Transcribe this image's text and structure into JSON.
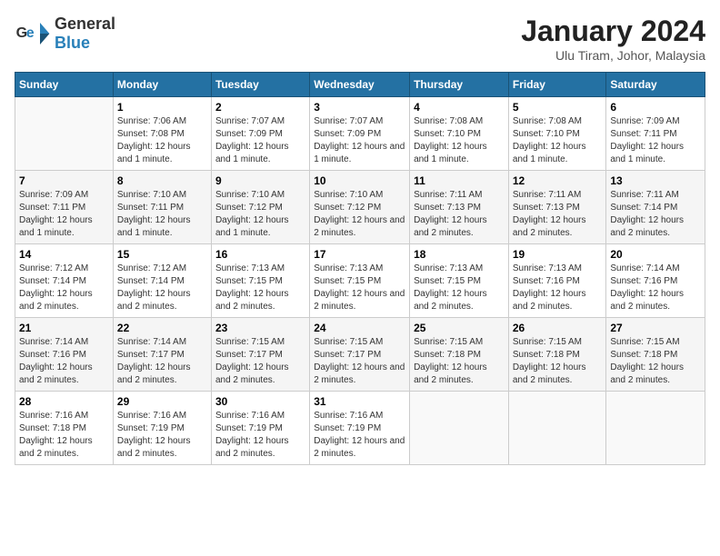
{
  "header": {
    "logo_general": "General",
    "logo_blue": "Blue",
    "month_title": "January 2024",
    "location": "Ulu Tiram, Johor, Malaysia"
  },
  "days_of_week": [
    "Sunday",
    "Monday",
    "Tuesday",
    "Wednesday",
    "Thursday",
    "Friday",
    "Saturday"
  ],
  "weeks": [
    [
      {
        "num": "",
        "sunrise": "",
        "sunset": "",
        "daylight": ""
      },
      {
        "num": "1",
        "sunrise": "Sunrise: 7:06 AM",
        "sunset": "Sunset: 7:08 PM",
        "daylight": "Daylight: 12 hours and 1 minute."
      },
      {
        "num": "2",
        "sunrise": "Sunrise: 7:07 AM",
        "sunset": "Sunset: 7:09 PM",
        "daylight": "Daylight: 12 hours and 1 minute."
      },
      {
        "num": "3",
        "sunrise": "Sunrise: 7:07 AM",
        "sunset": "Sunset: 7:09 PM",
        "daylight": "Daylight: 12 hours and 1 minute."
      },
      {
        "num": "4",
        "sunrise": "Sunrise: 7:08 AM",
        "sunset": "Sunset: 7:10 PM",
        "daylight": "Daylight: 12 hours and 1 minute."
      },
      {
        "num": "5",
        "sunrise": "Sunrise: 7:08 AM",
        "sunset": "Sunset: 7:10 PM",
        "daylight": "Daylight: 12 hours and 1 minute."
      },
      {
        "num": "6",
        "sunrise": "Sunrise: 7:09 AM",
        "sunset": "Sunset: 7:11 PM",
        "daylight": "Daylight: 12 hours and 1 minute."
      }
    ],
    [
      {
        "num": "7",
        "sunrise": "Sunrise: 7:09 AM",
        "sunset": "Sunset: 7:11 PM",
        "daylight": "Daylight: 12 hours and 1 minute."
      },
      {
        "num": "8",
        "sunrise": "Sunrise: 7:10 AM",
        "sunset": "Sunset: 7:11 PM",
        "daylight": "Daylight: 12 hours and 1 minute."
      },
      {
        "num": "9",
        "sunrise": "Sunrise: 7:10 AM",
        "sunset": "Sunset: 7:12 PM",
        "daylight": "Daylight: 12 hours and 1 minute."
      },
      {
        "num": "10",
        "sunrise": "Sunrise: 7:10 AM",
        "sunset": "Sunset: 7:12 PM",
        "daylight": "Daylight: 12 hours and 2 minutes."
      },
      {
        "num": "11",
        "sunrise": "Sunrise: 7:11 AM",
        "sunset": "Sunset: 7:13 PM",
        "daylight": "Daylight: 12 hours and 2 minutes."
      },
      {
        "num": "12",
        "sunrise": "Sunrise: 7:11 AM",
        "sunset": "Sunset: 7:13 PM",
        "daylight": "Daylight: 12 hours and 2 minutes."
      },
      {
        "num": "13",
        "sunrise": "Sunrise: 7:11 AM",
        "sunset": "Sunset: 7:14 PM",
        "daylight": "Daylight: 12 hours and 2 minutes."
      }
    ],
    [
      {
        "num": "14",
        "sunrise": "Sunrise: 7:12 AM",
        "sunset": "Sunset: 7:14 PM",
        "daylight": "Daylight: 12 hours and 2 minutes."
      },
      {
        "num": "15",
        "sunrise": "Sunrise: 7:12 AM",
        "sunset": "Sunset: 7:14 PM",
        "daylight": "Daylight: 12 hours and 2 minutes."
      },
      {
        "num": "16",
        "sunrise": "Sunrise: 7:13 AM",
        "sunset": "Sunset: 7:15 PM",
        "daylight": "Daylight: 12 hours and 2 minutes."
      },
      {
        "num": "17",
        "sunrise": "Sunrise: 7:13 AM",
        "sunset": "Sunset: 7:15 PM",
        "daylight": "Daylight: 12 hours and 2 minutes."
      },
      {
        "num": "18",
        "sunrise": "Sunrise: 7:13 AM",
        "sunset": "Sunset: 7:15 PM",
        "daylight": "Daylight: 12 hours and 2 minutes."
      },
      {
        "num": "19",
        "sunrise": "Sunrise: 7:13 AM",
        "sunset": "Sunset: 7:16 PM",
        "daylight": "Daylight: 12 hours and 2 minutes."
      },
      {
        "num": "20",
        "sunrise": "Sunrise: 7:14 AM",
        "sunset": "Sunset: 7:16 PM",
        "daylight": "Daylight: 12 hours and 2 minutes."
      }
    ],
    [
      {
        "num": "21",
        "sunrise": "Sunrise: 7:14 AM",
        "sunset": "Sunset: 7:16 PM",
        "daylight": "Daylight: 12 hours and 2 minutes."
      },
      {
        "num": "22",
        "sunrise": "Sunrise: 7:14 AM",
        "sunset": "Sunset: 7:17 PM",
        "daylight": "Daylight: 12 hours and 2 minutes."
      },
      {
        "num": "23",
        "sunrise": "Sunrise: 7:15 AM",
        "sunset": "Sunset: 7:17 PM",
        "daylight": "Daylight: 12 hours and 2 minutes."
      },
      {
        "num": "24",
        "sunrise": "Sunrise: 7:15 AM",
        "sunset": "Sunset: 7:17 PM",
        "daylight": "Daylight: 12 hours and 2 minutes."
      },
      {
        "num": "25",
        "sunrise": "Sunrise: 7:15 AM",
        "sunset": "Sunset: 7:18 PM",
        "daylight": "Daylight: 12 hours and 2 minutes."
      },
      {
        "num": "26",
        "sunrise": "Sunrise: 7:15 AM",
        "sunset": "Sunset: 7:18 PM",
        "daylight": "Daylight: 12 hours and 2 minutes."
      },
      {
        "num": "27",
        "sunrise": "Sunrise: 7:15 AM",
        "sunset": "Sunset: 7:18 PM",
        "daylight": "Daylight: 12 hours and 2 minutes."
      }
    ],
    [
      {
        "num": "28",
        "sunrise": "Sunrise: 7:16 AM",
        "sunset": "Sunset: 7:18 PM",
        "daylight": "Daylight: 12 hours and 2 minutes."
      },
      {
        "num": "29",
        "sunrise": "Sunrise: 7:16 AM",
        "sunset": "Sunset: 7:19 PM",
        "daylight": "Daylight: 12 hours and 2 minutes."
      },
      {
        "num": "30",
        "sunrise": "Sunrise: 7:16 AM",
        "sunset": "Sunset: 7:19 PM",
        "daylight": "Daylight: 12 hours and 2 minutes."
      },
      {
        "num": "31",
        "sunrise": "Sunrise: 7:16 AM",
        "sunset": "Sunset: 7:19 PM",
        "daylight": "Daylight: 12 hours and 2 minutes."
      },
      {
        "num": "",
        "sunrise": "",
        "sunset": "",
        "daylight": ""
      },
      {
        "num": "",
        "sunrise": "",
        "sunset": "",
        "daylight": ""
      },
      {
        "num": "",
        "sunrise": "",
        "sunset": "",
        "daylight": ""
      }
    ]
  ]
}
